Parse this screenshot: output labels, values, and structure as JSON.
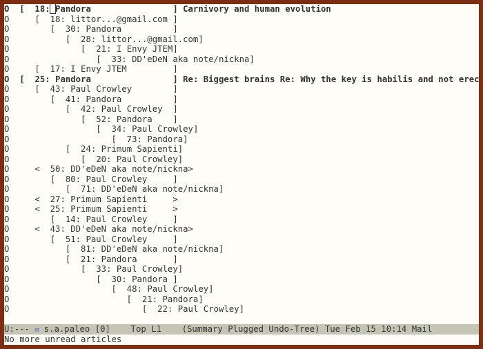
{
  "threads": [
    {
      "mark": "O",
      "indent": 0,
      "open": "[",
      "count": "18",
      "name": "Pandora",
      "close": "]",
      "subject": "Carnivory and human evolution",
      "cursor": true,
      "bold": true
    },
    {
      "mark": "O",
      "indent": 1,
      "open": "[",
      "count": "18",
      "name": "littor...@gmail.com",
      "close": "]",
      "subject": "",
      "bold": false
    },
    {
      "mark": "O",
      "indent": 2,
      "open": "[",
      "count": "30",
      "name": "Pandora",
      "close": "]",
      "subject": "",
      "bold": false
    },
    {
      "mark": "O",
      "indent": 3,
      "open": "[",
      "count": "28",
      "name": "littor...@gmail.com",
      "close": "]",
      "subject": "",
      "bold": false
    },
    {
      "mark": "O",
      "indent": 4,
      "open": "[",
      "count": "21",
      "name": "I Envy JTEM",
      "close": "]",
      "subject": "",
      "bold": false
    },
    {
      "mark": "O",
      "indent": 5,
      "open": "[",
      "count": "33",
      "name": "DD'eDeN aka note/nickna",
      "close": "]",
      "subject": "",
      "bold": false
    },
    {
      "mark": "O",
      "indent": 1,
      "open": "[",
      "count": "17",
      "name": "I Envy JTEM",
      "close": "]",
      "subject": "",
      "bold": false
    },
    {
      "mark": "O",
      "indent": 0,
      "open": "[",
      "count": "25",
      "name": "Pandora",
      "close": "]",
      "subject": "Re: Biggest brains Re: Why the key is habilis and not erectus",
      "bold": true
    },
    {
      "mark": "O",
      "indent": 1,
      "open": "[",
      "count": "43",
      "name": "Paul Crowley",
      "close": "]",
      "subject": "",
      "bold": false
    },
    {
      "mark": "O",
      "indent": 2,
      "open": "[",
      "count": "41",
      "name": "Pandora",
      "close": "]",
      "subject": "",
      "bold": false
    },
    {
      "mark": "O",
      "indent": 3,
      "open": "[",
      "count": "42",
      "name": "Paul Crowley",
      "close": "]",
      "subject": "",
      "bold": false
    },
    {
      "mark": "O",
      "indent": 4,
      "open": "[",
      "count": "52",
      "name": "Pandora",
      "close": "]",
      "subject": "",
      "bold": false
    },
    {
      "mark": "O",
      "indent": 5,
      "open": "[",
      "count": "34",
      "name": "Paul Crowley",
      "close": "]",
      "subject": "",
      "bold": false
    },
    {
      "mark": "O",
      "indent": 6,
      "open": "[",
      "count": "73",
      "name": "Pandora",
      "close": "]",
      "subject": "",
      "bold": false
    },
    {
      "mark": "O",
      "indent": 3,
      "open": "[",
      "count": "24",
      "name": "Primum Sapienti",
      "close": "]",
      "subject": "",
      "bold": false
    },
    {
      "mark": "O",
      "indent": 4,
      "open": "[",
      "count": "20",
      "name": "Paul Crowley",
      "close": "]",
      "subject": "",
      "bold": false
    },
    {
      "mark": "O",
      "indent": 1,
      "open": "<",
      "count": "50",
      "name": "DD'eDeN aka note/nickna",
      "close": ">",
      "subject": "",
      "bold": false
    },
    {
      "mark": "O",
      "indent": 2,
      "open": "[",
      "count": "80",
      "name": "Paul Crowley",
      "close": "]",
      "subject": "",
      "bold": false
    },
    {
      "mark": "O",
      "indent": 3,
      "open": "[",
      "count": "71",
      "name": "DD'eDeN aka note/nickna",
      "close": "]",
      "subject": "",
      "bold": false
    },
    {
      "mark": "O",
      "indent": 1,
      "open": "<",
      "count": "27",
      "name": "Primum Sapienti",
      "close": ">",
      "subject": "",
      "bold": false
    },
    {
      "mark": "O",
      "indent": 1,
      "open": "<",
      "count": "25",
      "name": "Primum Sapienti",
      "close": ">",
      "subject": "",
      "bold": false
    },
    {
      "mark": "O",
      "indent": 2,
      "open": "[",
      "count": "14",
      "name": "Paul Crowley",
      "close": "]",
      "subject": "",
      "bold": false
    },
    {
      "mark": "O",
      "indent": 1,
      "open": "<",
      "count": "43",
      "name": "DD'eDeN aka note/nickna",
      "close": ">",
      "subject": "",
      "bold": false
    },
    {
      "mark": "O",
      "indent": 2,
      "open": "[",
      "count": "51",
      "name": "Paul Crowley",
      "close": "]",
      "subject": "",
      "bold": false
    },
    {
      "mark": "O",
      "indent": 3,
      "open": "[",
      "count": "81",
      "name": "DD'eDeN aka note/nickna",
      "close": "]",
      "subject": "",
      "bold": false
    },
    {
      "mark": "O",
      "indent": 3,
      "open": "[",
      "count": "21",
      "name": "Pandora",
      "close": "]",
      "subject": "",
      "bold": false
    },
    {
      "mark": "O",
      "indent": 4,
      "open": "[",
      "count": "33",
      "name": "Paul Crowley",
      "close": "]",
      "subject": "",
      "bold": false
    },
    {
      "mark": "O",
      "indent": 5,
      "open": "[",
      "count": "30",
      "name": "Pandora",
      "close": "]",
      "subject": "",
      "bold": false
    },
    {
      "mark": "O",
      "indent": 6,
      "open": "[",
      "count": "48",
      "name": "Paul Crowley",
      "close": "]",
      "subject": "",
      "bold": false
    },
    {
      "mark": "O",
      "indent": 7,
      "open": "[",
      "count": "21",
      "name": "Pandora",
      "close": "]",
      "subject": "",
      "bold": false
    },
    {
      "mark": "O",
      "indent": 8,
      "open": "[",
      "count": "22",
      "name": "Paul Crowley",
      "close": "]",
      "subject": "",
      "bold": false
    }
  ],
  "name_field_width": 23,
  "modeline": {
    "left": "U:--- ",
    "buffer": "s.a.paleo [0]",
    "pos": "    Top L1    ",
    "modes": "(Summary Plugged Undo-Tree)",
    "time": " Tue Feb 15 10:14 ",
    "mode2": "Mail"
  },
  "echo_area": "No more unread articles"
}
